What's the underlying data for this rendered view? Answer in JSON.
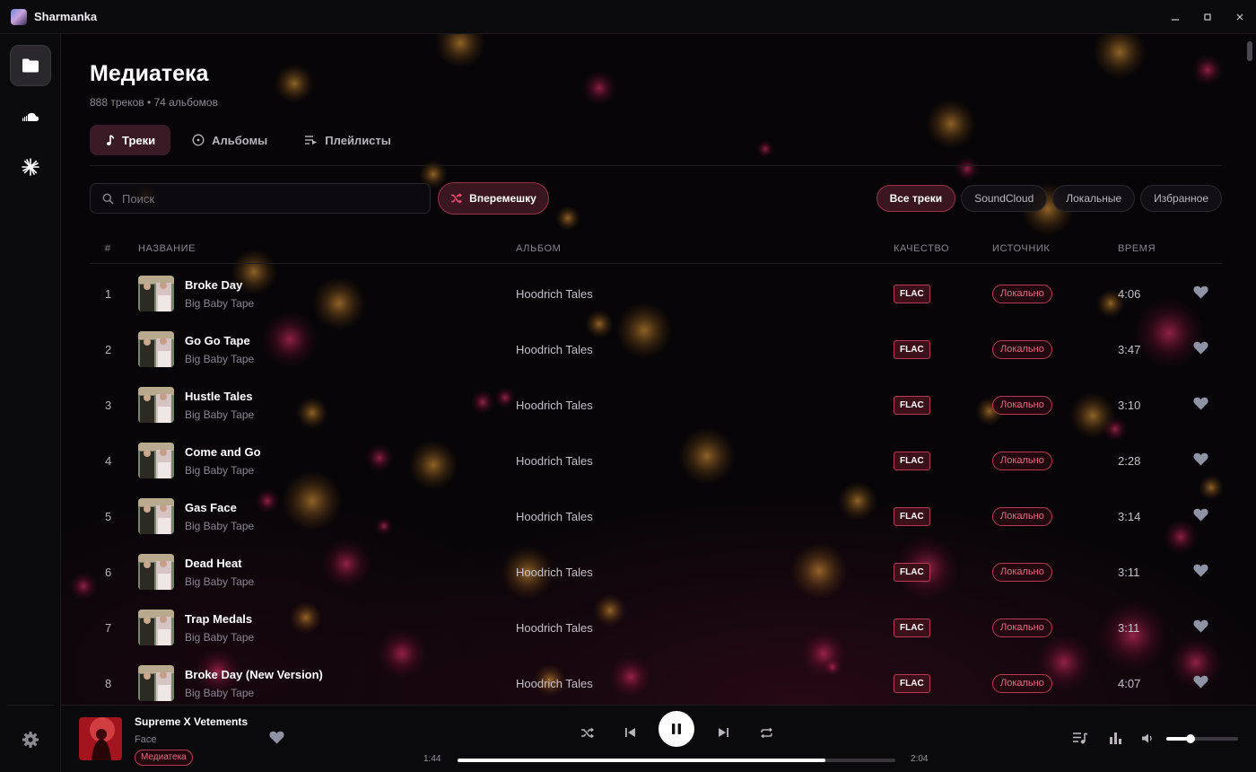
{
  "window": {
    "title": "Sharmanka"
  },
  "page": {
    "title": "Медиатека",
    "subtitle": "888 треков • 74 альбомов",
    "tabs": [
      {
        "label": "Треки",
        "icon": "music-note-icon",
        "active": true
      },
      {
        "label": "Альбомы",
        "icon": "disc-icon",
        "active": false
      },
      {
        "label": "Плейлисты",
        "icon": "playlist-icon",
        "active": false
      }
    ],
    "search_placeholder": "Поиск",
    "shuffle_label": "Вперемешку",
    "filters": [
      {
        "label": "Все треки",
        "active": true
      },
      {
        "label": "SoundCloud",
        "active": false
      },
      {
        "label": "Локальные",
        "active": false
      },
      {
        "label": "Избранное",
        "active": false
      }
    ]
  },
  "table": {
    "headers": {
      "num": "#",
      "title": "НАЗВАНИЕ",
      "album": "АЛЬБОМ",
      "quality": "КАЧЕСТВО",
      "source": "ИСТОЧНИК",
      "time": "ВРЕМЯ"
    },
    "rows": [
      {
        "num": "1",
        "title": "Broke Day",
        "artist": "Big Baby Tape",
        "album": "Hoodrich Tales",
        "quality": "FLAC",
        "source": "Локально",
        "time": "4:06"
      },
      {
        "num": "2",
        "title": "Go Go Tape",
        "artist": "Big Baby Tape",
        "album": "Hoodrich Tales",
        "quality": "FLAC",
        "source": "Локально",
        "time": "3:47"
      },
      {
        "num": "3",
        "title": "Hustle Tales",
        "artist": "Big Baby Tape",
        "album": "Hoodrich Tales",
        "quality": "FLAC",
        "source": "Локально",
        "time": "3:10"
      },
      {
        "num": "4",
        "title": "Come and Go",
        "artist": "Big Baby Tape",
        "album": "Hoodrich Tales",
        "quality": "FLAC",
        "source": "Локально",
        "time": "2:28"
      },
      {
        "num": "5",
        "title": "Gas Face",
        "artist": "Big Baby Tape",
        "album": "Hoodrich Tales",
        "quality": "FLAC",
        "source": "Локально",
        "time": "3:14"
      },
      {
        "num": "6",
        "title": "Dead Heat",
        "artist": "Big Baby Tape",
        "album": "Hoodrich Tales",
        "quality": "FLAC",
        "source": "Локально",
        "time": "3:11"
      },
      {
        "num": "7",
        "title": "Trap Medals",
        "artist": "Big Baby Tape",
        "album": "Hoodrich Tales",
        "quality": "FLAC",
        "source": "Локально",
        "time": "3:11"
      },
      {
        "num": "8",
        "title": "Broke Day (New Version)",
        "artist": "Big Baby Tape",
        "album": "Hoodrich Tales",
        "quality": "FLAC",
        "source": "Локально",
        "time": "4:07"
      }
    ]
  },
  "player": {
    "title": "Supreme X Vetements",
    "artist": "Face",
    "source_badge": "Медиатека",
    "current_time": "1:44",
    "duration": "2:04",
    "progress": 0.84,
    "volume": 0.34,
    "state": "playing"
  },
  "sidebar": {
    "items": [
      {
        "name": "library",
        "icon": "folder-icon",
        "active": true
      },
      {
        "name": "soundcloud",
        "icon": "soundcloud-icon",
        "active": false
      },
      {
        "name": "discover",
        "icon": "sparkle-icon",
        "active": false
      }
    ],
    "settings_icon": "gear-icon"
  },
  "colors": {
    "accent": "#b93a55",
    "accent_text": "#e26a82",
    "background": "#070508",
    "active_tab_bg": "#3a1a24"
  }
}
